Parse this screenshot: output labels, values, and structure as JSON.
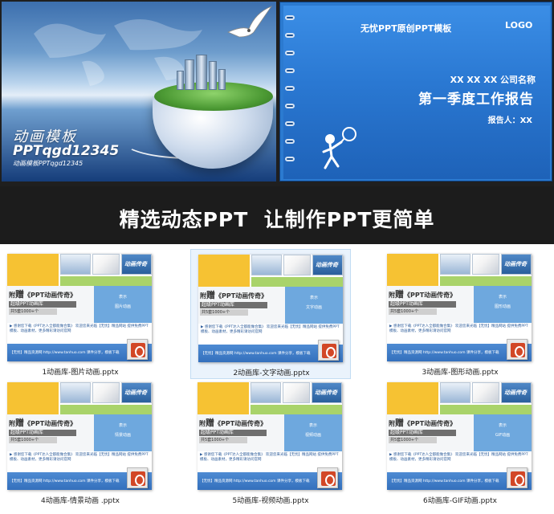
{
  "banner": {
    "left_slide": {
      "title": "动画模板",
      "code": "PPTqgd12345",
      "subtitle": "动画模板PPTqgd12345"
    },
    "right_slide": {
      "header": "无忧PPT原创PPT模板",
      "logo": "LOGO",
      "company": "XX XX XX 公司名称",
      "report_title": "第一季度工作报告",
      "reporter": "报告人：XX"
    }
  },
  "slogan": "精选动态PPT  让制作PPT更简单",
  "thumb_template": {
    "gift": "附",
    "gift_big": "赠",
    "gift_tail": "《PPT动画传奇》",
    "bar1": "超级PPT动画库",
    "bar2": "共5套1000+个",
    "card3": "动画传奇",
    "body_text": "▶ 感谢您下载《PPT达人全都能做合集》 欢迎您来光临【无忧】精品网站 提供免费PPT模板、动画素材，更多精彩请访问官网",
    "footer_text": "【无忧】精品资源网 http://www.tanhuo.com 课件分享，模板下载"
  },
  "files": [
    {
      "label": "1动画库-图片动画.pptx",
      "blue_line1": "表示",
      "blue_line2": "图片动画",
      "selected": false
    },
    {
      "label": "2动画库-文字动画.pptx",
      "blue_line1": "表示",
      "blue_line2": "文字动画",
      "selected": true
    },
    {
      "label": "3动画库-图形动画.pptx",
      "blue_line1": "表示",
      "blue_line2": "图形动画",
      "selected": false
    },
    {
      "label": "4动画库-情景动画 .pptx",
      "blue_line1": "表示",
      "blue_line2": "情景动画",
      "selected": false
    },
    {
      "label": "5动画库-视频动画.pptx",
      "blue_line1": "表示",
      "blue_line2": "视频动画",
      "selected": false
    },
    {
      "label": "6动画库-GIF动画.pptx",
      "blue_line1": "表示",
      "blue_line2": "GIF动画",
      "selected": false
    }
  ]
}
